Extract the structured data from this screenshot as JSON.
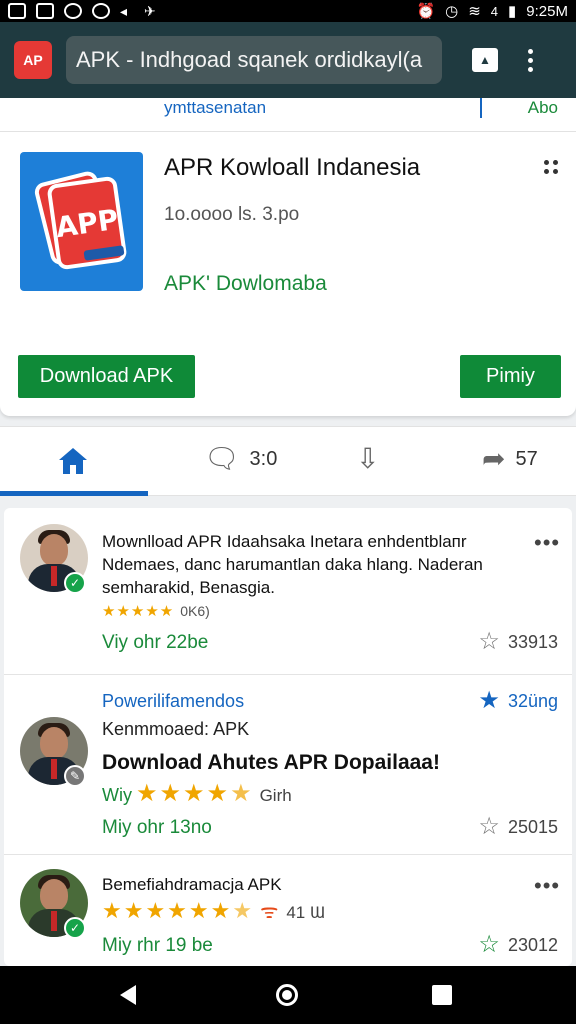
{
  "status_bar": {
    "time": "9:25M",
    "signal_label": "4"
  },
  "app_bar": {
    "logo_text": "AP",
    "url_text": "APK - Indhgoad sqanek ordidkayl(a"
  },
  "top_strip": {
    "left_text": "ymttasenatan",
    "right_text": "Abo"
  },
  "app_card": {
    "icon_text": "APP",
    "title": "APR Kowloall Indanesia",
    "subtitle": "1o.oooo ls. 3.po",
    "green_text": "APK' Dowlomaba",
    "primary_button": "Download APK",
    "secondary_button": "Pimiy"
  },
  "action_tabs": {
    "comments_count": "3:0",
    "share_count": "57"
  },
  "posts": [
    {
      "title": "Mownlload APR Idaahsaka Inetara enhdentblaпr Ndemaes, danc harumantlan daka hlang. Nаderan semharakid, Benasgia.",
      "rating_count": "0K6)",
      "meta": "Viy ohr  22be",
      "count": "33913"
    },
    {
      "header": "Powerilifamendos",
      "header_right": "32üng",
      "subline": "Kenmmoaed: APK",
      "big_text": "Download Ahutes APR Dopailaaa!",
      "rating_label": "Wiy",
      "rating_count": "Girh",
      "meta": "Miy ohr  13no",
      "count": "25015"
    },
    {
      "title": "Bemefiahdramacja APK",
      "rating_count": "41 Ɯ",
      "meta": "Miy rhr  19 be",
      "count": "23012"
    }
  ],
  "colors": {
    "accent_green": "#0f8a38",
    "accent_blue": "#1565c0",
    "app_bar": "#1f3a40"
  }
}
